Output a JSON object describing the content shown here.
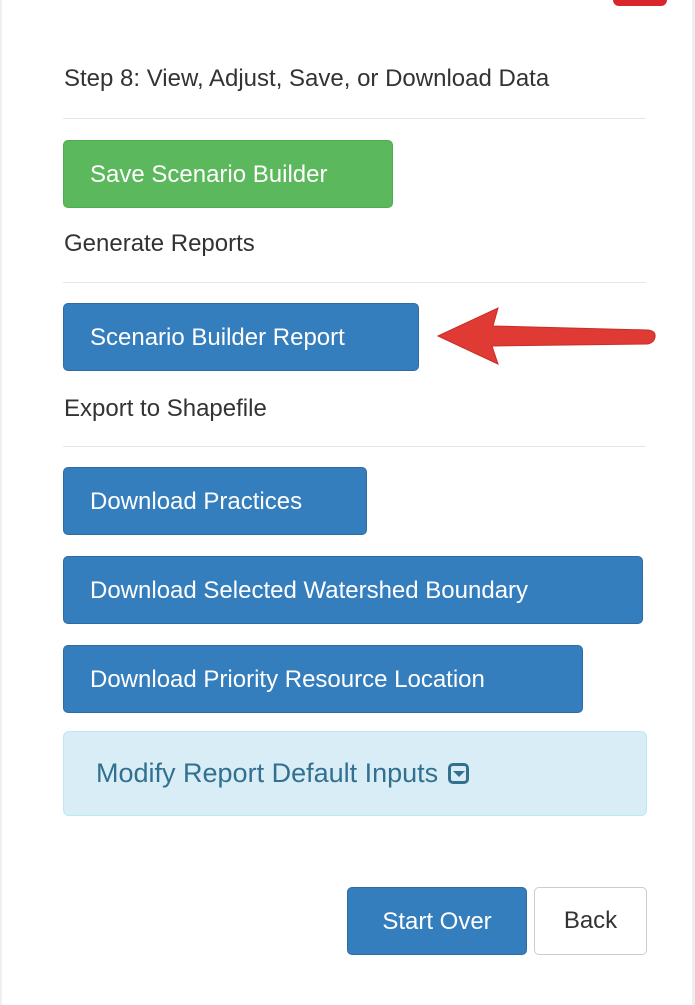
{
  "step_heading": "Step 8: View, Adjust, Save, or Download Data",
  "save_button": "Save Scenario Builder",
  "reports_heading": "Generate Reports",
  "report_button": "Scenario Builder Report",
  "export_heading": "Export to Shapefile",
  "downloads": {
    "practices": "Download Practices",
    "watershed": "Download Selected Watershed Boundary",
    "priority": "Download Priority Resource Location"
  },
  "modify_inputs": {
    "label": "Modify Report Default Inputs",
    "icon": "caret-square-down-icon"
  },
  "footer": {
    "start_over": "Start Over",
    "back": "Back"
  },
  "colors": {
    "primary": "#357ebd",
    "success": "#5cb85c",
    "info_bg": "#d9edf7",
    "info_text": "#31708f",
    "annotation_arrow": "#e03a34"
  }
}
